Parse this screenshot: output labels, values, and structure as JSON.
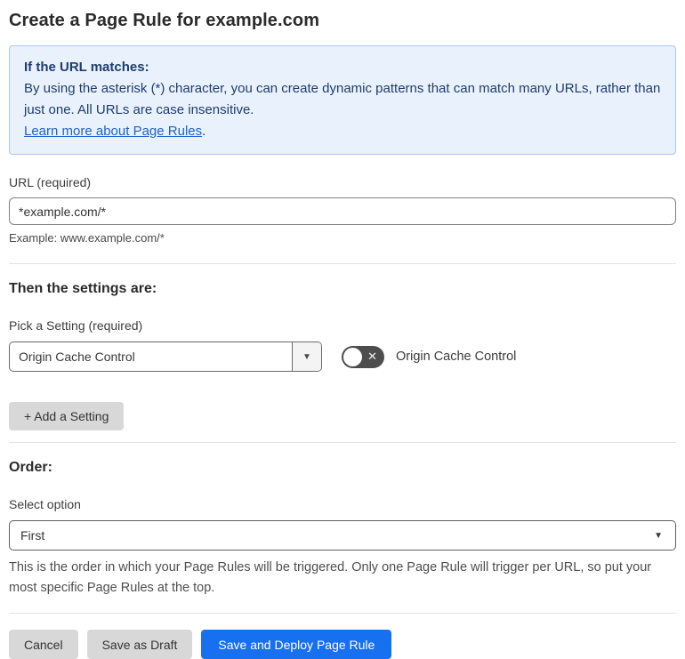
{
  "page": {
    "title": "Create a Page Rule for example.com"
  },
  "info_box": {
    "heading": "If the URL matches:",
    "body": "By using the asterisk (*) character, you can create dynamic patterns that can match many URLs, rather than just one. All URLs are case insensitive.",
    "link_label": "Learn more about Page Rules",
    "link_suffix": "."
  },
  "url_field": {
    "label": "URL (required)",
    "value": "*example.com/*",
    "example": "Example: www.example.com/*"
  },
  "settings_section": {
    "heading": "Then the settings are:",
    "picker_label": "Pick a Setting (required)",
    "selected_setting": "Origin Cache Control",
    "toggle_state": "off",
    "toggle_label": "Origin Cache Control",
    "add_setting_label": "+ Add a Setting"
  },
  "order_section": {
    "heading": "Order:",
    "select_label": "Select option",
    "selected_option": "First",
    "help_text": "This is the order in which your Page Rules will be triggered. Only one Page Rule will trigger per URL, so put your most specific Page Rules at the top."
  },
  "footer": {
    "cancel_label": "Cancel",
    "save_draft_label": "Save as Draft",
    "save_deploy_label": "Save and Deploy Page Rule"
  },
  "icons": {
    "dropdown_arrow": "▼",
    "toggle_off_x": "✕"
  },
  "colors": {
    "info_background": "#e9f2fc",
    "info_border": "#a9c9ec",
    "info_text": "#1e3c6e",
    "link_blue": "#2262c9",
    "primary_button_blue": "#1670f0",
    "secondary_button_gray": "#d8d8d8",
    "toggle_off_background": "#4d4d4d"
  }
}
